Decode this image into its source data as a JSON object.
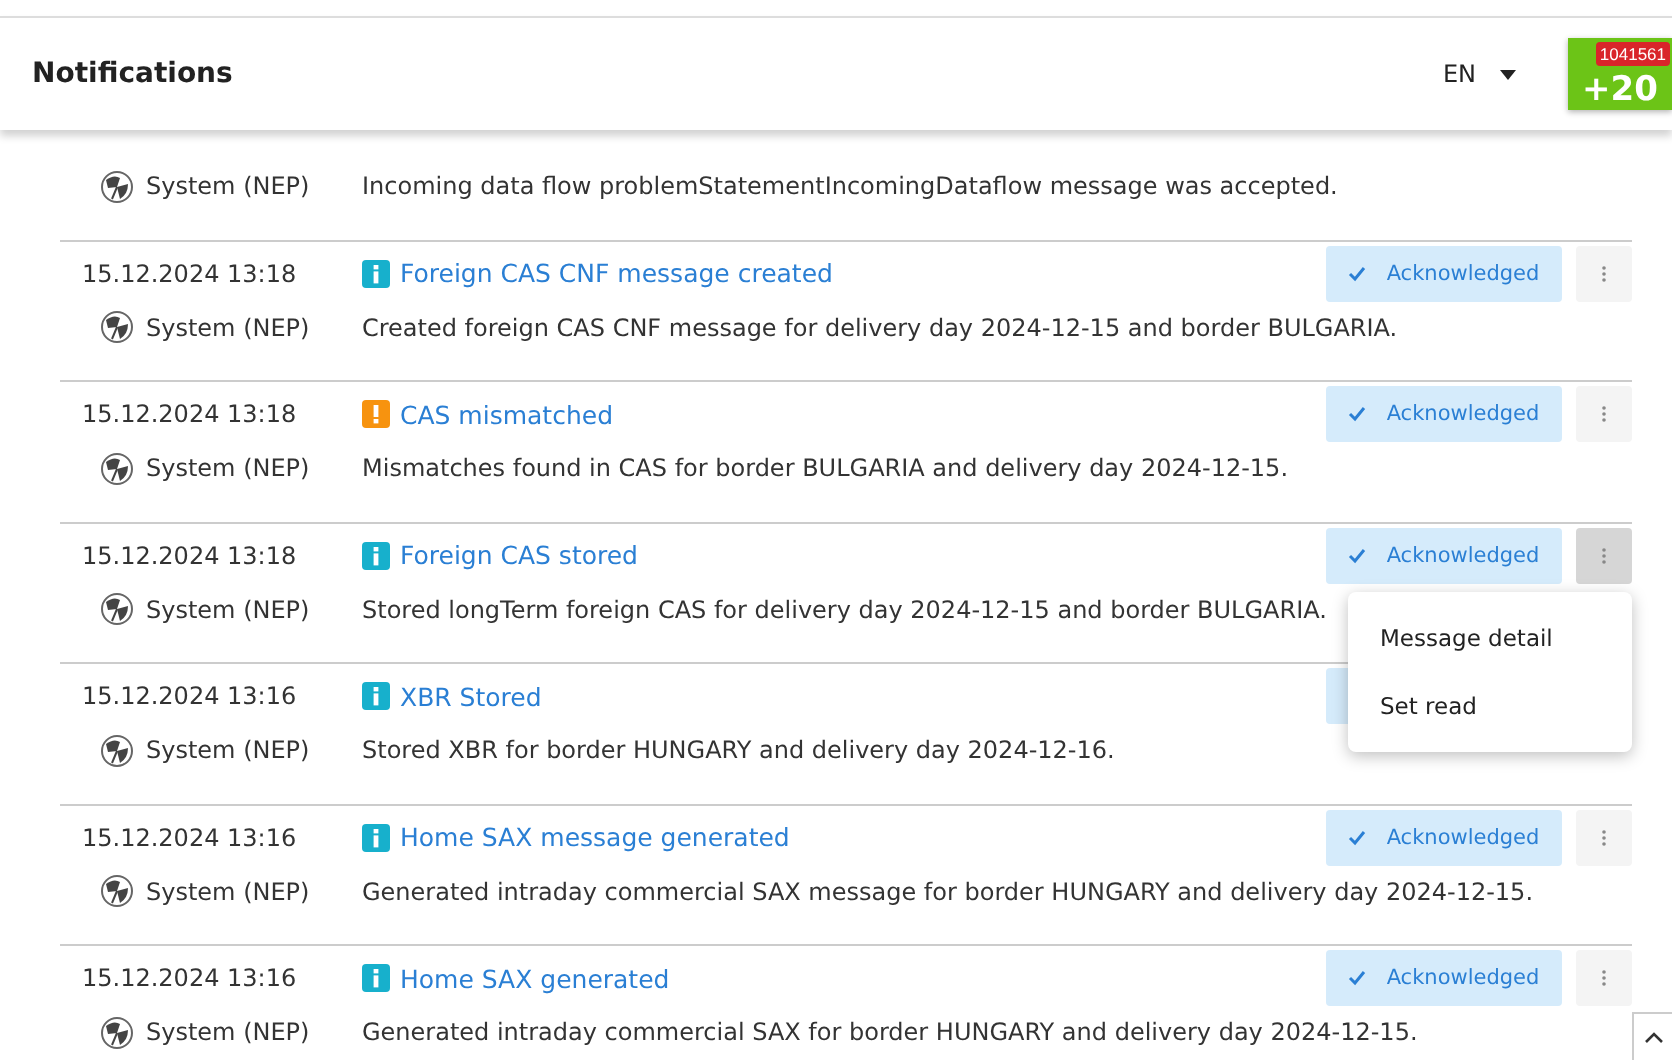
{
  "header": {
    "title": "Notifications",
    "language": "EN",
    "counter": "+20",
    "counter_badge": "1041561"
  },
  "notifications": [
    {
      "sender": "System (NEP)",
      "message": "Incoming data flow problemStatementIncomingDataflow message was accepted."
    },
    {
      "date": "15.12.2024 13:18",
      "kind": "info",
      "title": "Foreign CAS CNF message created",
      "sender": "System (NEP)",
      "message": "Created foreign CAS CNF message for delivery day 2024-12-15 and border BULGARIA.",
      "status": "Acknowledged"
    },
    {
      "date": "15.12.2024 13:18",
      "kind": "warning",
      "title": "CAS mismatched",
      "sender": "System (NEP)",
      "message": "Mismatches found in CAS for border BULGARIA and delivery day 2024-12-15.",
      "status": "Acknowledged"
    },
    {
      "date": "15.12.2024 13:18",
      "kind": "info",
      "title": "Foreign CAS stored",
      "sender": "System (NEP)",
      "message": "Stored longTerm foreign CAS for delivery day 2024-12-15 and border BULGARIA.",
      "status": "Acknowledged",
      "menu": [
        "Message detail",
        "Set read"
      ]
    },
    {
      "date": "15.12.2024 13:16",
      "kind": "info",
      "title": "XBR Stored",
      "sender": "System (NEP)",
      "message": "Stored XBR for border HUNGARY and delivery day 2024-12-16."
    },
    {
      "date": "15.12.2024 13:16",
      "kind": "info",
      "title": "Home SAX message generated",
      "sender": "System (NEP)",
      "message": "Generated intraday commercial SAX message for border HUNGARY and delivery day 2024-12-15.",
      "status": "Acknowledged"
    },
    {
      "date": "15.12.2024 13:16",
      "kind": "info",
      "title": "Home SAX generated",
      "sender": "System (NEP)",
      "message": "Generated intraday commercial SAX for border HUNGARY and delivery day 2024-12-15.",
      "status": "Acknowledged"
    }
  ]
}
